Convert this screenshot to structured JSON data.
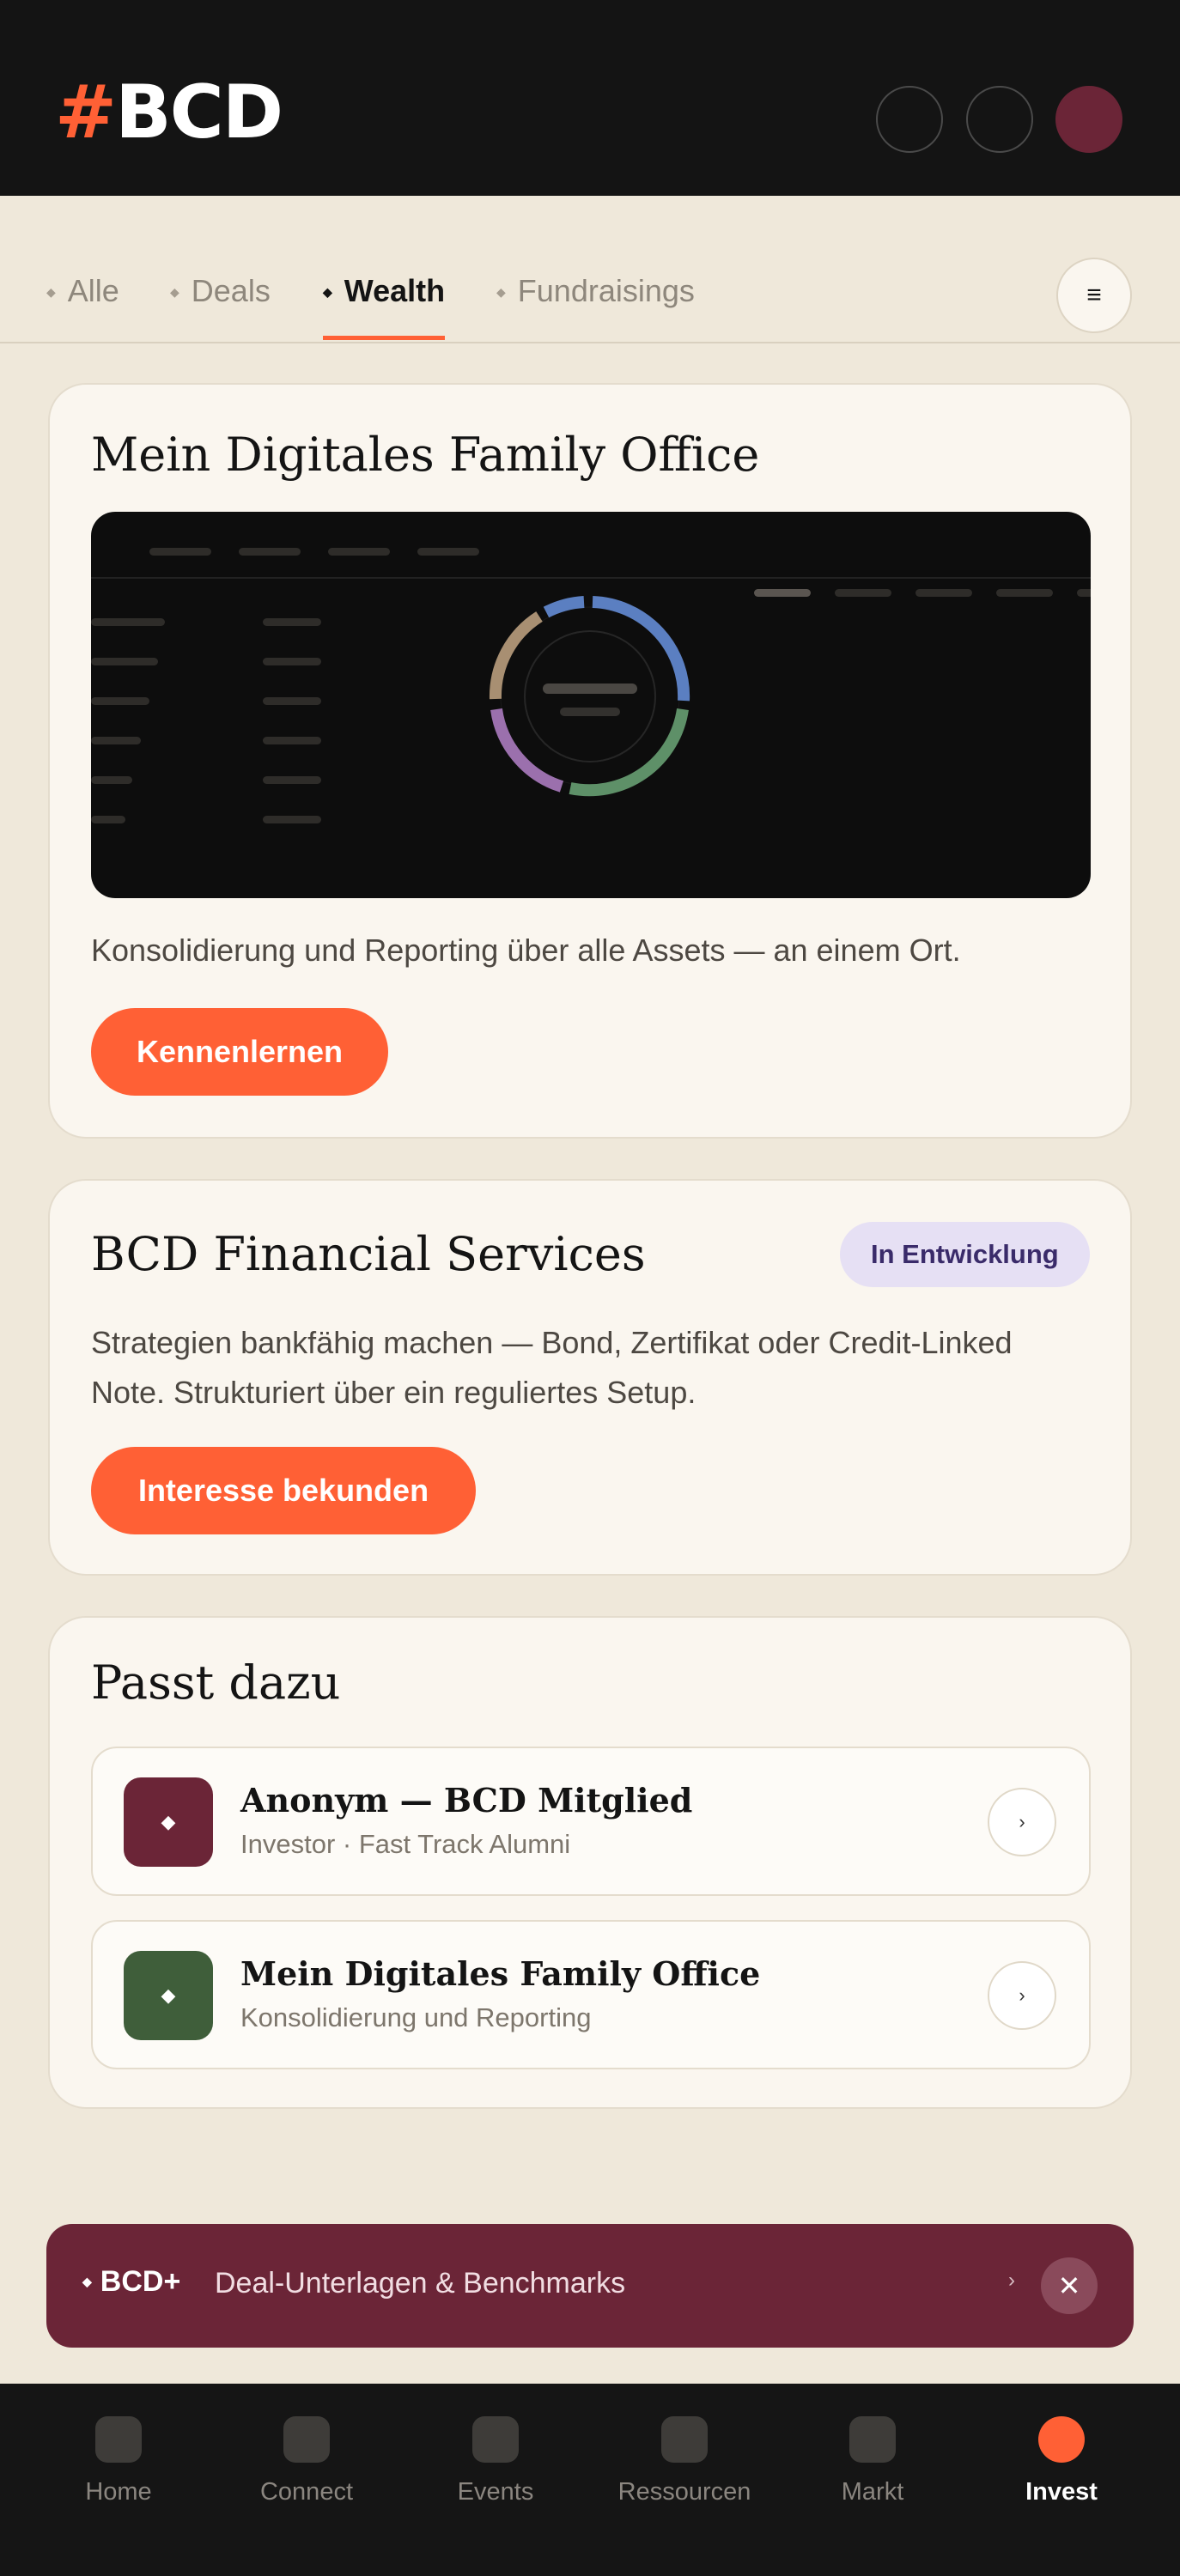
{
  "brand": {
    "hash": "#",
    "name": "BCD"
  },
  "tabs": [
    {
      "label": "Alle",
      "active": false
    },
    {
      "label": "Deals",
      "active": false
    },
    {
      "label": "Wealth",
      "active": true
    },
    {
      "label": "Fundraisings",
      "active": false
    }
  ],
  "menu_icon": "≡",
  "family_office": {
    "title": "Mein Digitales Family Office",
    "description": "Konsolidierung und Reporting über alle Assets — an einem Ort.",
    "button": "Kennenlernen"
  },
  "financial_services": {
    "title": "BCD Financial Services",
    "badge": "In Entwicklung",
    "description_line1": "Strategien bankfähig machen — Bond, Zertifikat oder Credit-Linked",
    "description_line2": "Note. Strukturiert über ein reguliertes Setup.",
    "button": "Interesse bekunden"
  },
  "related": {
    "title": "Passt dazu",
    "items": [
      {
        "title": "Anonym — BCD Mitglied",
        "subtitle": "Investor · Fast Track Alumni",
        "icon": "◆",
        "color": "#6b2537"
      },
      {
        "title": "Mein Digitales Family Office",
        "subtitle": "Konsolidierung und Reporting",
        "icon": "◆",
        "color": "#3f5e3a"
      }
    ]
  },
  "promo": {
    "brand": "BCD+",
    "text": "Deal-Unterlagen & Benchmarks",
    "chevron": "›",
    "close": "✕"
  },
  "nav": [
    {
      "label": "Home",
      "active": false
    },
    {
      "label": "Connect",
      "active": false
    },
    {
      "label": "Events",
      "active": false
    },
    {
      "label": "Ressourcen",
      "active": false
    },
    {
      "label": "Markt",
      "active": false
    },
    {
      "label": "Invest",
      "active": true
    }
  ],
  "colors": {
    "accent": "#ff6035",
    "burgundy": "#6b2537",
    "green": "#3f5e3a",
    "background": "#efe8da",
    "donut": [
      "#5b7fc1",
      "#5e9068",
      "#9b70ad",
      "#a88f72"
    ]
  }
}
